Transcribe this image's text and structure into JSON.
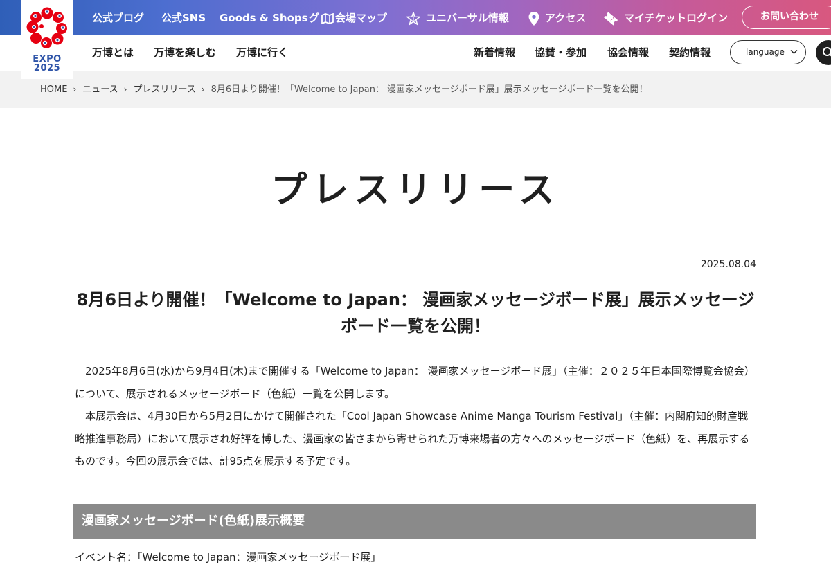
{
  "logo": {
    "text_line1": "EXPO",
    "text_line2": "2025"
  },
  "topbar": {
    "links": {
      "blog": "公式ブログ",
      "sns": "公式SNS",
      "goods": "Goods & Shops",
      "guide_prefix": "グ",
      "map": "会場マップ",
      "universal": "ユニバーサル情報",
      "access": "アクセス",
      "ticket": "マイチケットログイン"
    },
    "contact_label": "お問い合わせ"
  },
  "subnav": {
    "left": {
      "about": "万博とは",
      "enjoy": "万博を楽しむ",
      "visit": "万博に行く"
    },
    "right": {
      "news": "新着情報",
      "sponsor": "協賛・参加",
      "association": "協会情報",
      "contract": "契約情報"
    },
    "language_label": "language"
  },
  "breadcrumb": {
    "home": "HOME",
    "news": "ニュース",
    "press": "プレスリリース",
    "current": "8月6日より開催！「Welcome to Japan： 漫画家メッセージボード展」展示メッセージボード一覧を公開！"
  },
  "page_title": "プレスリリース",
  "article": {
    "date": "2025.08.04",
    "title": "8月6日より開催！「Welcome to Japan： 漫画家メッセージボード展」展示メッセージボード一覧を公開！",
    "paragraph1": "2025年8月6日(水)から9月4日(木)まで開催する「Welcome to Japan： 漫画家メッセージボード展」（主催：２０２５年日本国際博覧会協会）について、展示されるメッセージボード（色紙）一覧を公開します。",
    "paragraph2": "本展示会は、4月30日から5月2日にかけて開催された「Cool Japan Showcase Anime Manga Tourism Festival」（主催：内閣府知的財産戦略推進事務局）において展示され好評を博した、漫画家の皆さまから寄せられた万博来場者の方々へのメッセージボード（色紙）を、再展示するものです。今回の展示会では、計95点を展示する予定です。",
    "section_heading": "漫画家メッセージボード(色紙)展示概要",
    "event_name_line": "イベント名：「Welcome to Japan：漫画家メッセージボード展」"
  },
  "colors": {
    "gradient_start": "#2f5fb8",
    "gradient_end": "#d8587f",
    "logo_red": "#e60012",
    "logo_blue": "#2e54a8",
    "section_gray": "#8a8a8a",
    "breadcrumb_bg": "#f2f2f2"
  }
}
